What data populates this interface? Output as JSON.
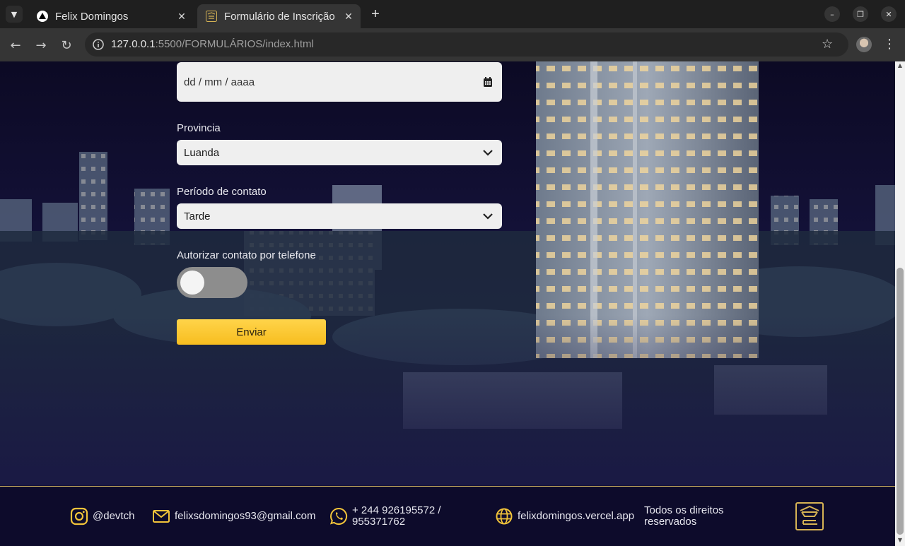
{
  "browser": {
    "tabs": [
      {
        "title": "Felix Domingos",
        "active": false,
        "favicon": "triangle-logo-icon"
      },
      {
        "title": "Formulário de Inscrição",
        "active": true,
        "favicon": "crown-logo-icon"
      }
    ],
    "url_host": "127.0.0.1",
    "url_rest": ":5500/FORMULÁRIOS/index.html"
  },
  "form": {
    "date_placeholder": "dd / mm / aaaa",
    "province_label": "Provincia",
    "province_value": "Luanda",
    "period_label": "Período de contato",
    "period_value": "Tarde",
    "phone_consent_label": "Autorizar contato por telefone",
    "phone_consent_on": false,
    "submit_label": "Enviar"
  },
  "footer": {
    "instagram": "@devtch",
    "email": "felixsdomingos93@gmail.com",
    "phone_line1": "+ 244  926195572 /",
    "phone_line2": "955371762",
    "website": "felixdomingos.vercel.app",
    "rights_line1": "Todos os direitos",
    "rights_line2": "reservados"
  },
  "colors": {
    "accent_yellow": "#f9c833",
    "gold_line": "#c9ad5e",
    "footer_bg": "#0d0b2b"
  }
}
